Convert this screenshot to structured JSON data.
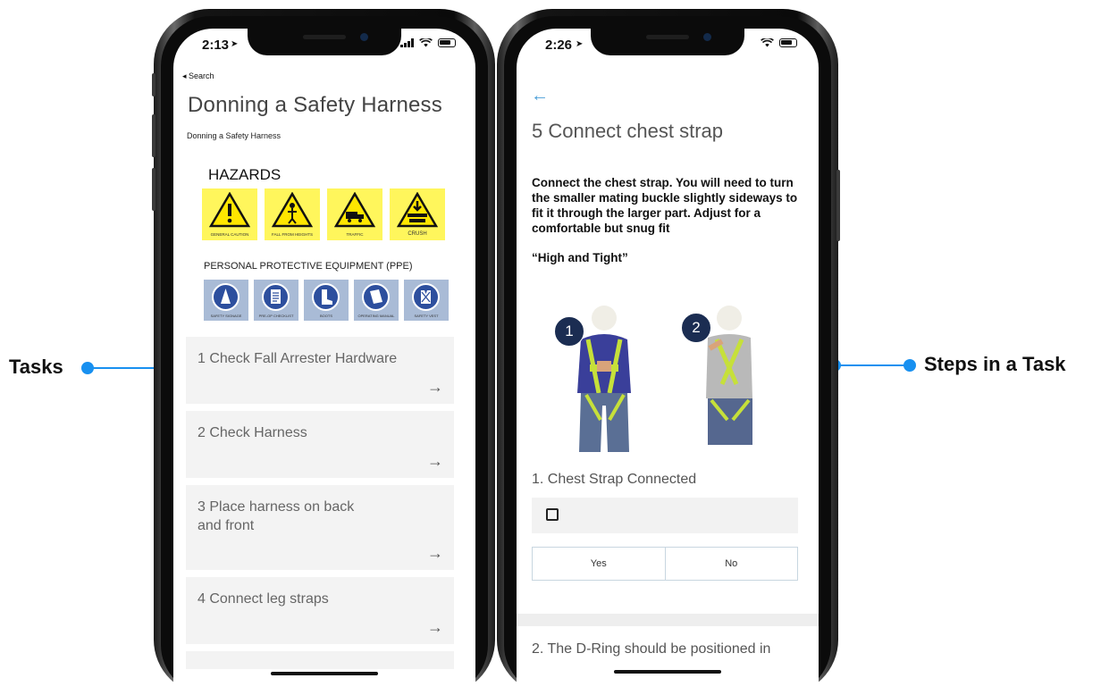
{
  "callouts": {
    "left": "Tasks",
    "right": "Steps in a Task"
  },
  "left_phone": {
    "status": {
      "time": "2:13",
      "back_app": "◂ Search"
    },
    "title": "Donning a Safety Harness",
    "subtitle": "Donning a Safety Harness",
    "hazards": {
      "title": "HAZARDS",
      "items": [
        "GENERAL CAUTION",
        "FALL FROM HEIGHTS",
        "TRAFFIC",
        "CRUSH"
      ]
    },
    "ppe": {
      "title": "PERSONAL PROTECTIVE EQUIPMENT (PPE)",
      "items": [
        "SAFETY SIGNAGE",
        "PRE-OP CHECKLIST",
        "BOOTS",
        "OPERATING MANUAL",
        "SAFETY VEST"
      ]
    },
    "tasks": [
      {
        "label": "1 Check Fall Arrester Hardware",
        "arrow": "→"
      },
      {
        "label": "2 Check Harness",
        "arrow": "→"
      },
      {
        "label": "3 Place harness on back and front",
        "arrow": "→"
      },
      {
        "label": "4 Connect leg straps",
        "arrow": "→"
      }
    ]
  },
  "right_phone": {
    "status": {
      "time": "2:26"
    },
    "back_icon": "←",
    "title": "5 Connect chest strap",
    "description": "Connect the chest strap. You will need to turn the smaller mating buckle slightly sideways to fit it through the larger part. Adjust for a comfortable but snug fit",
    "quote": "“High and Tight”",
    "illustration": {
      "badge1": "1",
      "badge2": "2"
    },
    "step": {
      "label": "1. Chest Strap Connected",
      "yes": "Yes",
      "no": "No"
    },
    "next_step": "2. The D-Ring should be positioned in"
  },
  "colors": {
    "accent": "#1890f0",
    "hazard_yellow": "#fff65c",
    "ppe_blue": "#2d4f9e",
    "back_arrow": "#4a9ed8"
  }
}
